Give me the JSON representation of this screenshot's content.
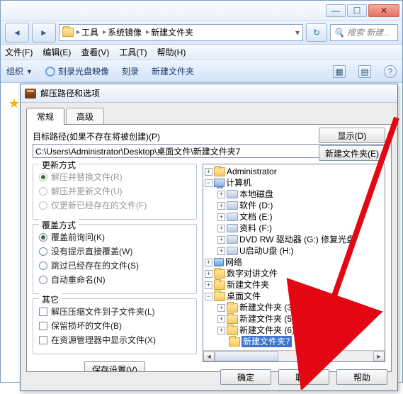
{
  "explorer": {
    "breadcrumbs": [
      "工具",
      "系统镜像",
      "新建文件夹"
    ],
    "search_placeholder": "搜索 新建...",
    "menus": {
      "file": "文件(F)",
      "edit": "编辑(E)",
      "view": "查看(V)",
      "tools": "工具(T)",
      "help": "帮助(H)"
    },
    "toolbar": {
      "organize": "组织",
      "burn_image": "刻录光盘映像",
      "burn": "刻录",
      "new_folder": "新建文件夹"
    }
  },
  "dialog": {
    "title": "解压路径和选项",
    "tabs": {
      "general": "常规",
      "advanced": "高级"
    },
    "path_label": "目标路径(如果不存在将被创建)(P)",
    "path_value": "C:\\Users\\Administrator\\Desktop\\桌面文件\\新建文件夹7",
    "buttons": {
      "display": "显示(D)",
      "new_folder": "新建文件夹(E)",
      "save": "保存设置(V)",
      "ok": "确定",
      "cancel": "取消",
      "help": "帮助"
    },
    "update_mode": {
      "legend": "更新方式",
      "opt1": "解压并替换文件(R)",
      "opt2": "解压并更新文件(U)",
      "opt3": "仅更新已经存在的文件(F)"
    },
    "overwrite_mode": {
      "legend": "覆盖方式",
      "opt1": "覆盖前询问(K)",
      "opt2": "没有提示直接覆盖(W)",
      "opt3": "跳过已经存在的文件(S)",
      "opt4": "自动重命名(N)"
    },
    "misc": {
      "legend": "其它",
      "opt1": "解压压缩文件到子文件夹(L)",
      "opt2": "保留损坏的文件(B)",
      "opt3": "在资源管理器中显示文件(X)"
    },
    "tree": {
      "admin": "Administrator",
      "computer": "计算机",
      "local_disk": "本地磁盘",
      "software": "软件  (D:)",
      "docs": "文档  (E:)",
      "data": "资料  (F:)",
      "dvd": "DVD RW 驱动器  (G:) 修复光盘",
      "udisk": "U启动U盘  (H:)",
      "network": "网络",
      "digital": "数字对讲文件",
      "newfolder": "新建文件夹",
      "desktop": "桌面文件",
      "nf3": "新建文件夹 (3)",
      "nf5": "新建文件夹 (5)",
      "nf6": "新建文件夹 (6)",
      "nf7": "新建文件夹7"
    }
  }
}
